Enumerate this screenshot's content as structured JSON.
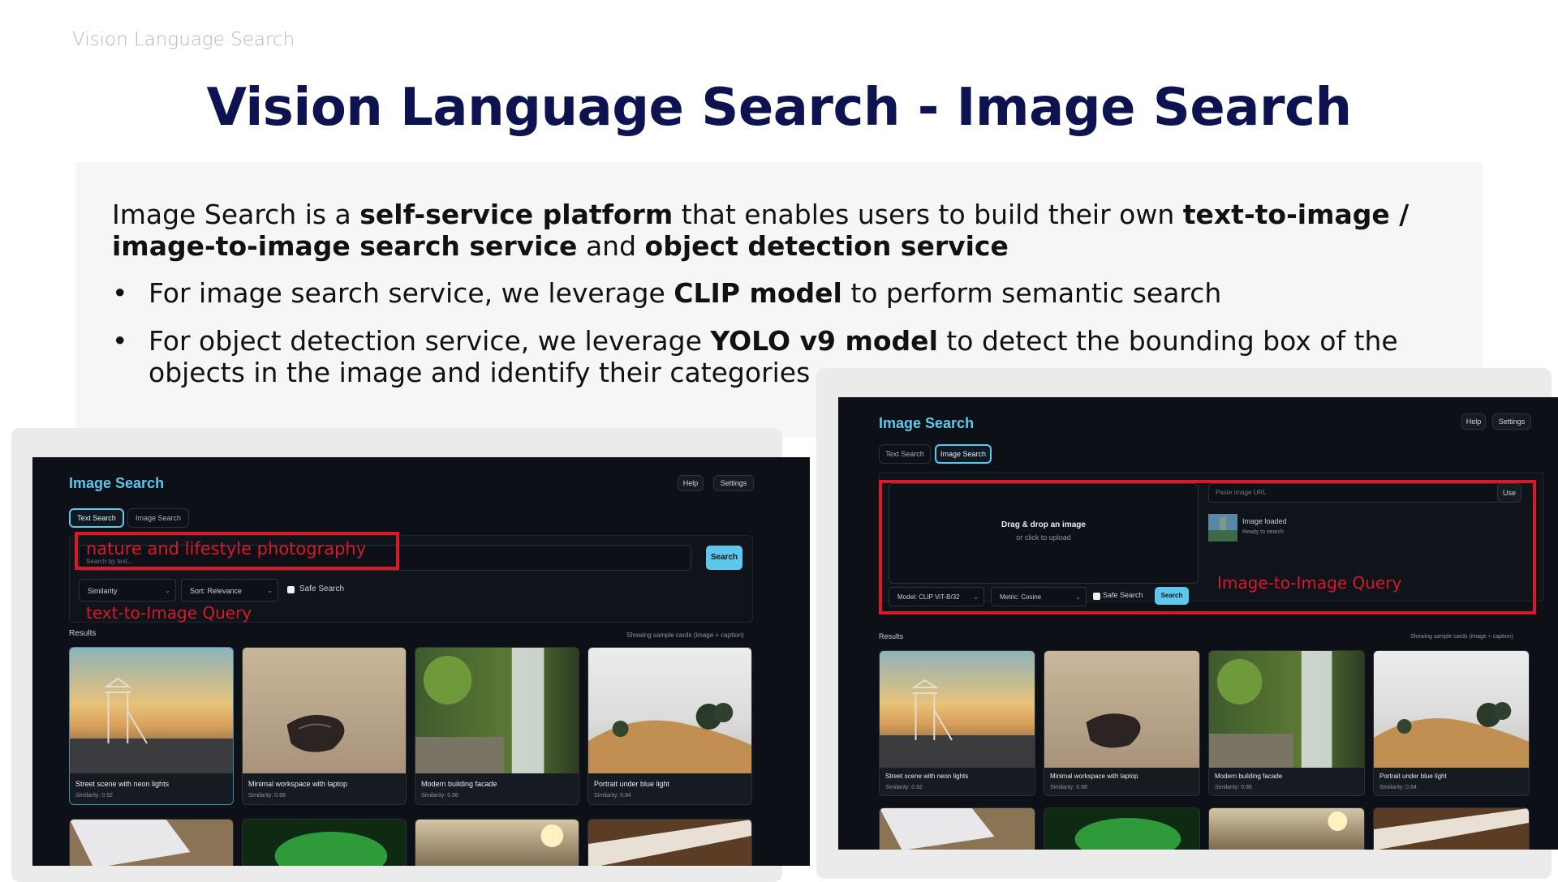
{
  "slide": {
    "header": "Vision Language Search",
    "title": "Vision Language Search - Image Search",
    "intro": {
      "t1": "Image Search is a ",
      "b1": "self-service platform",
      "t2": " that enables users to build their own ",
      "b2": "text-to-image / image-to-image search service",
      "t3": " and ",
      "b3": "object detection service"
    },
    "bullets": [
      {
        "pre": "For image search service, we leverage ",
        "bold": "CLIP model",
        "post": " to perform semantic search"
      },
      {
        "pre": "For object detection service, we leverage ",
        "bold": "YOLO v9 model",
        "post": " to detect the bounding box of the objects in the image and identify their categories"
      }
    ],
    "bullet_glyph": "•"
  },
  "left_app": {
    "title": "Image Search",
    "help": "Help",
    "settings": "Settings",
    "tabs": [
      "Text Search",
      "Image Search"
    ],
    "search_placeholder": "Search by text...",
    "search_button": "Search",
    "query_text": "nature and lifestyle photography",
    "annotation": "text-to-Image Query",
    "filters": {
      "similarity": "Similarity",
      "sort": "Sort: Relevance",
      "safe": "Safe Search"
    },
    "results_label": "Results",
    "results_note": "Showing sample cards (image + caption)",
    "cards": [
      {
        "caption": "Street scene with neon lights",
        "similarity": "Similarity: 0.92"
      },
      {
        "caption": "Minimal workspace with laptop",
        "similarity": "Similarity: 0.88"
      },
      {
        "caption": "Modern building facade",
        "similarity": "Similarity: 0.86"
      },
      {
        "caption": "Portrait under blue light",
        "similarity": "Similarity: 0.84"
      }
    ]
  },
  "right_app": {
    "title": "Image Search",
    "help": "Help",
    "settings": "Settings",
    "tabs": [
      "Text Search",
      "Image Search"
    ],
    "drop_title": "Drag & drop an image",
    "drop_sub": "or click to upload",
    "url_placeholder": "Paste image URL",
    "use_button": "Use",
    "loaded_title": "Image loaded",
    "loaded_sub": "Ready to search",
    "model": "Model: CLIP ViT-B/32",
    "metric": "Metric: Cosine",
    "safe": "Safe Search",
    "search_button": "Search",
    "annotation": "Image-to-Image Query",
    "results_label": "Results",
    "results_note": "Showing sample cards (image + caption)",
    "cards": [
      {
        "caption": "Street scene with neon lights",
        "similarity": "Similarity: 0.92"
      },
      {
        "caption": "Minimal workspace with laptop",
        "similarity": "Similarity: 0.88"
      },
      {
        "caption": "Modern building facade",
        "similarity": "Similarity: 0.86"
      },
      {
        "caption": "Portrait under blue light",
        "similarity": "Similarity: 0.84"
      }
    ]
  },
  "icons": {
    "chevron": "chevron-down-icon"
  },
  "colors": {
    "title": "#0d1250",
    "accent": "#5ec8ec",
    "annotation": "#d8182b",
    "app_bg": "#0d1117"
  }
}
